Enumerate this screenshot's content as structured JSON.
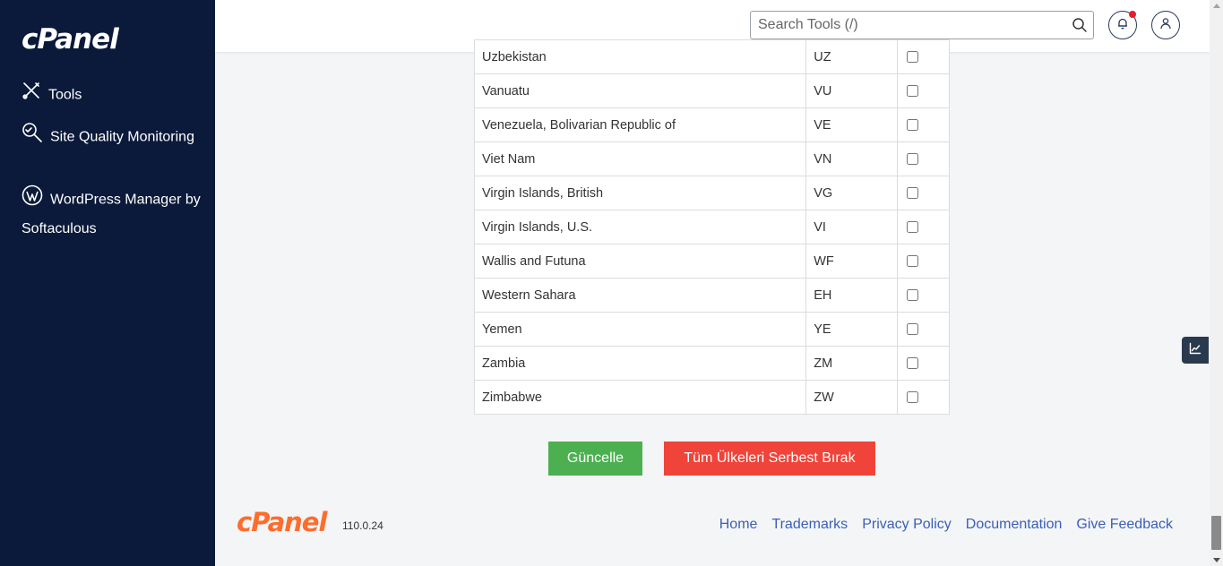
{
  "sidebar": {
    "logo": "cPanel",
    "items": [
      {
        "label": "Tools"
      },
      {
        "label": "Site Quality Monitoring"
      },
      {
        "label": "WordPress Manager by Softaculous"
      }
    ]
  },
  "header": {
    "search_placeholder": "Search Tools (/)"
  },
  "table": {
    "rows": [
      {
        "country": "Uzbekistan",
        "code": "UZ"
      },
      {
        "country": "Vanuatu",
        "code": "VU"
      },
      {
        "country": "Venezuela, Bolivarian Republic of",
        "code": "VE"
      },
      {
        "country": "Viet Nam",
        "code": "VN"
      },
      {
        "country": "Virgin Islands, British",
        "code": "VG"
      },
      {
        "country": "Virgin Islands, U.S.",
        "code": "VI"
      },
      {
        "country": "Wallis and Futuna",
        "code": "WF"
      },
      {
        "country": "Western Sahara",
        "code": "EH"
      },
      {
        "country": "Yemen",
        "code": "YE"
      },
      {
        "country": "Zambia",
        "code": "ZM"
      },
      {
        "country": "Zimbabwe",
        "code": "ZW"
      }
    ]
  },
  "actions": {
    "update_label": "Güncelle",
    "release_all_label": "Tüm Ülkeleri Serbest Bırak"
  },
  "footer": {
    "logo": "cPanel",
    "version": "110.0.24",
    "links": [
      "Home",
      "Trademarks",
      "Privacy Policy",
      "Documentation",
      "Give Feedback"
    ]
  },
  "colors": {
    "sidebar_bg": "#0b1a3a",
    "update_button": "#4cb050",
    "release_button": "#f0443a",
    "footer_logo": "#ff6c2c",
    "link": "#3b5fb5",
    "notification_dot": "#e0202e"
  },
  "icons": {
    "tools": "tools-icon",
    "site_quality": "magnifier-icon",
    "wordpress": "wordpress-icon",
    "search": "search-icon",
    "notifications": "bell-icon",
    "user": "user-icon",
    "analytics": "chart-icon"
  }
}
